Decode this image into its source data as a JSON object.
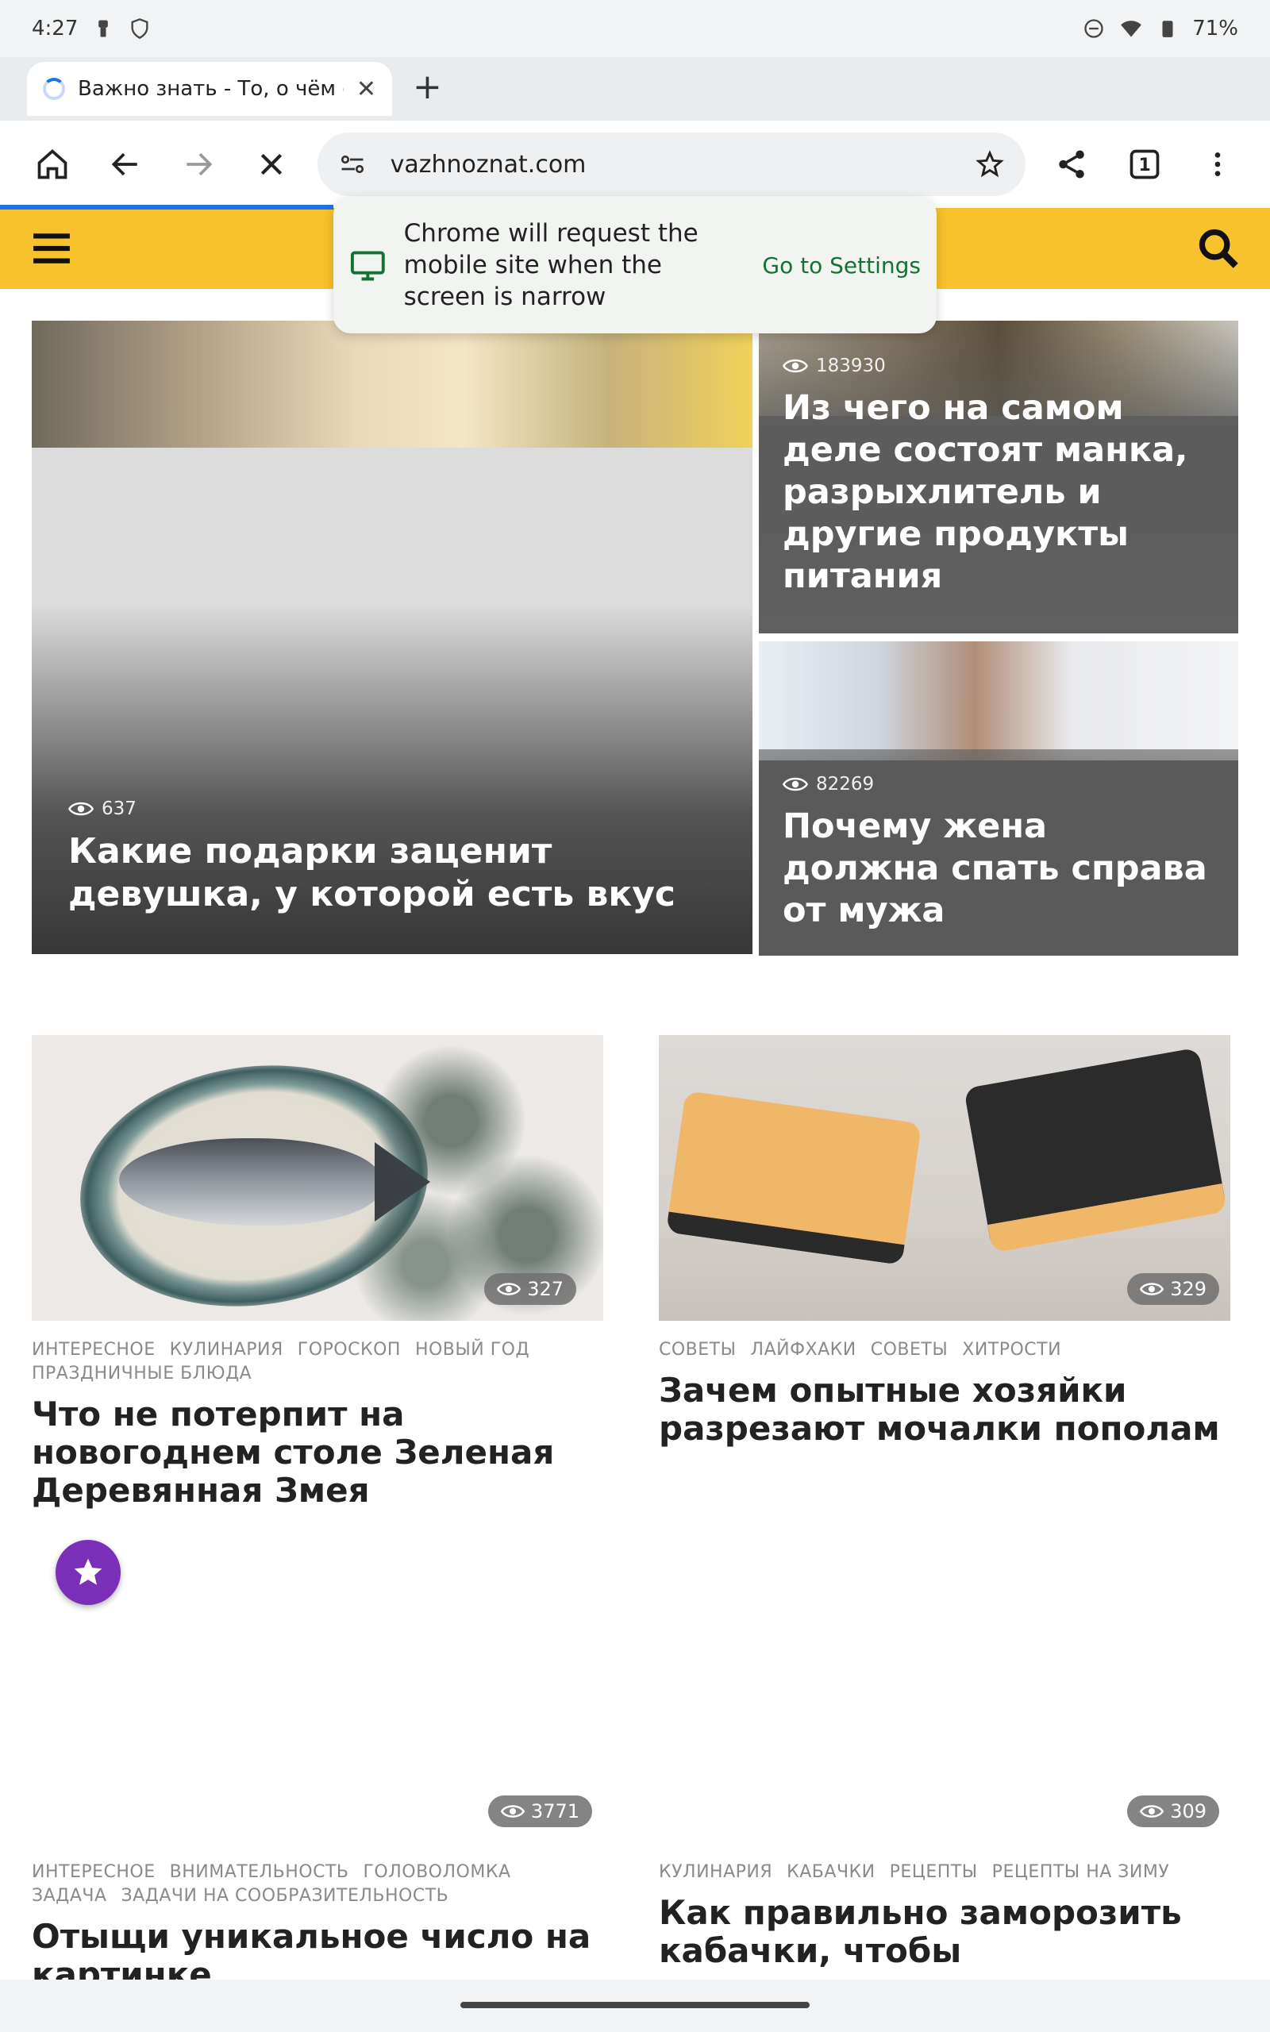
{
  "status_bar": {
    "time": "4:27",
    "battery": "71%",
    "icons": [
      "usb-icon",
      "shield-icon",
      "dnd-icon",
      "wifi-icon",
      "battery-icon"
    ]
  },
  "tab": {
    "title": "Важно знать - То, о чём сто"
  },
  "omnibox": {
    "url": "vazhnoznat.com"
  },
  "tab_count": "1",
  "popup": {
    "message": "Chrome will request the mobile site when the screen is narrow",
    "action": "Go to Settings"
  },
  "hero": {
    "views": "637",
    "title": "Какие подарки заценит девушка, у которой есть вкус"
  },
  "side_cards": [
    {
      "views": "183930",
      "title": "Из чего на самом деле состоят манка, разрыхлитель и другие продукты питания"
    },
    {
      "views": "82269",
      "title": "Почему жена должна спать справа от мужа"
    }
  ],
  "cards": [
    {
      "views": "327",
      "tags_line1": [
        "ИНТЕРЕСНОЕ",
        "КУЛИНАРИЯ",
        "ГОРОСКОП",
        "НОВЫЙ ГОД"
      ],
      "tags_line2": [
        "ПРАЗДНИЧНЫЕ БЛЮДА"
      ],
      "title": "Что не потерпит на новогоднем столе Зеленая Деревянная Змея"
    },
    {
      "views": "329",
      "tags_line1": [
        "СОВЕТЫ",
        "ЛАЙФХАКИ",
        "СОВЕТЫ",
        "ХИТРОСТИ"
      ],
      "tags_line2": [],
      "title": "Зачем опытные хозяйки разрезают мочалки пополам"
    },
    {
      "views": "3771",
      "tags_line1": [
        "ИНТЕРЕСНОЕ",
        "ВНИМАТЕЛЬНОСТЬ",
        "ГОЛОВОЛОМКА"
      ],
      "tags_line2": [
        "ЗАДАЧА",
        "ЗАДАЧИ НА СООБРАЗИТЕЛЬНОСТЬ"
      ],
      "title": "Отыщи уникальное число на картинке"
    },
    {
      "views": "309",
      "tags_line1": [
        "КУЛИНАРИЯ",
        "КАБАЧКИ",
        "РЕЦЕПТЫ",
        "РЕЦЕПТЫ НА ЗИМУ"
      ],
      "tags_line2": [],
      "title": "Как правильно заморозить кабачки, чтобы наслаждаться"
    }
  ],
  "colors": {
    "site_header": "#f7c22c",
    "fab": "#7b2fb8",
    "popup_link": "#137333",
    "loading": "#1a73e8"
  }
}
